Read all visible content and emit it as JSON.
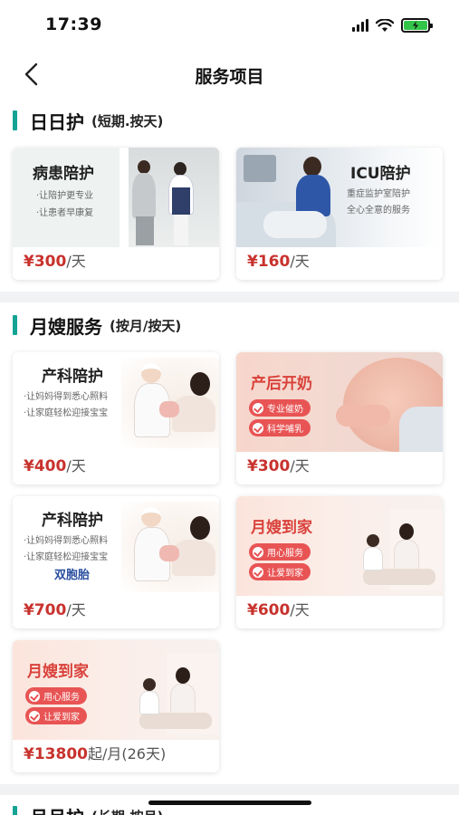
{
  "status": {
    "time": "17:39"
  },
  "nav": {
    "title": "服务项目"
  },
  "sections": [
    {
      "title": "日日护",
      "subtitle": "(短期.按天)",
      "cards": [
        {
          "img_title": "病患陪护",
          "img_lines": [
            "·让陪护更专业",
            "·让患者早康复"
          ],
          "price": "¥300",
          "unit": "/天"
        },
        {
          "img_title": "ICU陪护",
          "img_lines": [
            "重症监护室陪护",
            "全心全意的服务"
          ],
          "price": "¥160",
          "unit": "/天"
        }
      ]
    },
    {
      "title": "月嫂服务",
      "subtitle": "(按月/按天)",
      "cards": [
        {
          "img_title": "产科陪护",
          "img_lines": [
            "·让妈妈得到悉心照料",
            "·让家庭轻松迎接宝宝"
          ],
          "price": "¥400",
          "unit": "/天"
        },
        {
          "img_title": "产后开奶",
          "img_tags": [
            "专业催奶",
            "科学哺乳"
          ],
          "price": "¥300",
          "unit": "/天"
        },
        {
          "img_title": "产科陪护",
          "img_lines": [
            "·让妈妈得到悉心照料",
            "·让家庭轻松迎接宝宝"
          ],
          "img_extra": "双胞胎",
          "price": "¥700",
          "unit": "/天"
        },
        {
          "img_title": "月嫂到家",
          "img_tags": [
            "用心服务",
            "让爱到家"
          ],
          "price": "¥600",
          "unit": "/天"
        },
        {
          "img_title": "月嫂到家",
          "img_tags": [
            "用心服务",
            "让爱到家"
          ],
          "price": "¥13800",
          "unit": "起/月(26天)"
        }
      ]
    },
    {
      "title": "月月护",
      "subtitle": "(长期.按月)"
    }
  ],
  "colors": {
    "accent": "#14a394",
    "price": "#c8322d",
    "tag": "#e85454"
  }
}
